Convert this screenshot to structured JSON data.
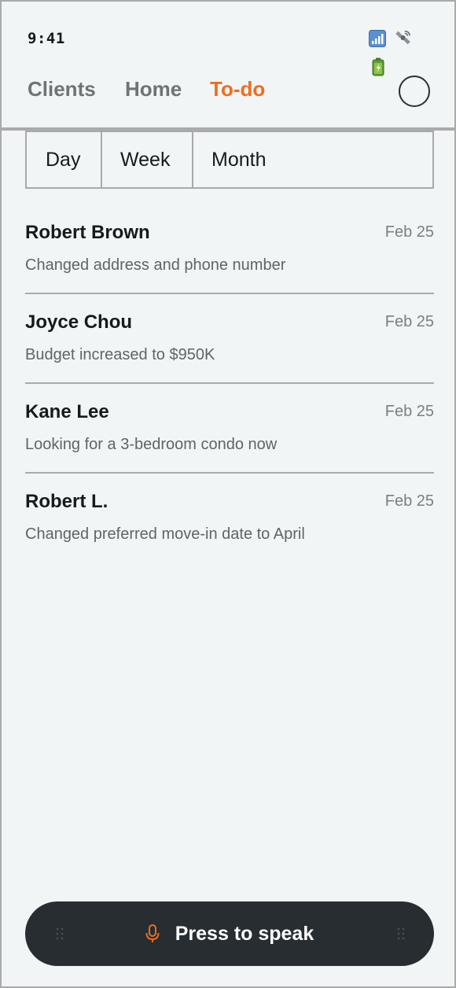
{
  "status_bar": {
    "time": "9:41",
    "icons": [
      "signal-icon",
      "satellite-icon",
      "battery-icon"
    ]
  },
  "nav": {
    "tabs": [
      {
        "label": "Clients",
        "active": false
      },
      {
        "label": "Home",
        "active": false
      },
      {
        "label": "To-do",
        "active": true
      }
    ],
    "active_color": "#f06c1e",
    "inactive_color": "#707376"
  },
  "period_selector": {
    "options": [
      "Day",
      "Week",
      "Month"
    ]
  },
  "activity": {
    "items": [
      {
        "name": "Robert Brown",
        "date": "Feb 25",
        "description": "Changed address and phone number"
      },
      {
        "name": "Joyce Chou",
        "date": "Feb 25",
        "description": "Budget increased to $950K"
      },
      {
        "name": "Kane Lee",
        "date": "Feb 25",
        "description": "Looking for a 3-bedroom condo now"
      },
      {
        "name": "Robert L.",
        "date": "Feb 25",
        "description": "Changed preferred move-in date to April"
      }
    ]
  },
  "voice": {
    "label": "Press to speak",
    "icon": "microphone-icon",
    "accent": "#f06c1e"
  },
  "colors": {
    "background": "#f1f5f6",
    "dark": "#272d30",
    "border": "#a9aaaa"
  }
}
